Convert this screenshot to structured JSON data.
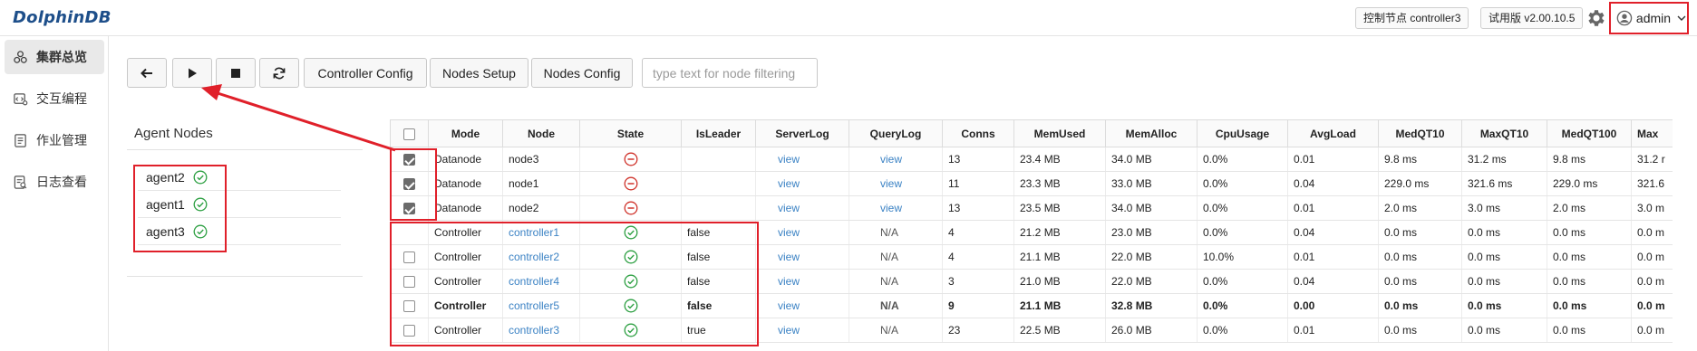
{
  "header": {
    "logo": "DolphinDB",
    "controller_badge": "控制节点 controller3",
    "version_badge": "试用版 v2.00.10.5",
    "username": "admin"
  },
  "sidebar": {
    "items": [
      {
        "label": "集群总览",
        "icon": "cluster-icon",
        "active": true
      },
      {
        "label": "交互编程",
        "icon": "code-icon",
        "active": false
      },
      {
        "label": "作业管理",
        "icon": "jobs-icon",
        "active": false
      },
      {
        "label": "日志查看",
        "icon": "log-icon",
        "active": false
      }
    ]
  },
  "toolbar": {
    "back_icon": "arrow-left-icon",
    "start_icon": "play-icon",
    "stop_icon": "stop-icon",
    "refresh_icon": "refresh-icon",
    "controller_config": "Controller Config",
    "nodes_setup": "Nodes Setup",
    "nodes_config": "Nodes Config",
    "filter_placeholder": "type text for node filtering"
  },
  "agent_panel": {
    "title": "Agent Nodes",
    "agents": [
      "agent2",
      "agent1",
      "agent3"
    ]
  },
  "colors": {
    "ok": "#2ea043",
    "stopped": "#d0342c",
    "link": "#3b82c4",
    "annotation": "#e0202a"
  },
  "table": {
    "headers": [
      "Mode",
      "Node",
      "State",
      "IsLeader",
      "ServerLog",
      "QueryLog",
      "Conns",
      "MemUsed",
      "MemAlloc",
      "CpuUsage",
      "AvgLoad",
      "MedQT10",
      "MaxQT10",
      "MedQT100",
      "Max"
    ],
    "rows": [
      {
        "checked": true,
        "checkbox": true,
        "mode": "Datanode",
        "node": "node3",
        "state": "stopped",
        "isLeader": "",
        "serverLog": "view",
        "queryLog": "view",
        "conns": "13",
        "memUsed": "23.4 MB",
        "memAlloc": "34.0 MB",
        "cpu": "0.0%",
        "avgLoad": "0.01",
        "medQT10": "9.8 ms",
        "maxQT10": "31.2 ms",
        "medQT100": "9.8 ms",
        "max": "31.2 r"
      },
      {
        "checked": true,
        "checkbox": true,
        "mode": "Datanode",
        "node": "node1",
        "state": "stopped",
        "isLeader": "",
        "serverLog": "view",
        "queryLog": "view",
        "conns": "11",
        "memUsed": "23.3 MB",
        "memAlloc": "33.0 MB",
        "cpu": "0.0%",
        "avgLoad": "0.04",
        "medQT10": "229.0 ms",
        "maxQT10": "321.6 ms",
        "medQT100": "229.0 ms",
        "max": "321.6"
      },
      {
        "checked": true,
        "checkbox": true,
        "mode": "Datanode",
        "node": "node2",
        "state": "stopped",
        "isLeader": "",
        "serverLog": "view",
        "queryLog": "view",
        "conns": "13",
        "memUsed": "23.5 MB",
        "memAlloc": "34.0 MB",
        "cpu": "0.0%",
        "avgLoad": "0.01",
        "medQT10": "2.0 ms",
        "maxQT10": "3.0 ms",
        "medQT100": "2.0 ms",
        "max": "3.0 m"
      },
      {
        "checked": false,
        "checkbox": false,
        "mode": "Controller",
        "node": "controller1",
        "state": "running",
        "isLeader": "false",
        "serverLog": "view",
        "queryLog": "N/A",
        "conns": "4",
        "memUsed": "21.2 MB",
        "memAlloc": "23.0 MB",
        "cpu": "0.0%",
        "avgLoad": "0.04",
        "medQT10": "0.0 ms",
        "maxQT10": "0.0 ms",
        "medQT100": "0.0 ms",
        "max": "0.0 m"
      },
      {
        "checked": false,
        "checkbox": true,
        "mode": "Controller",
        "node": "controller2",
        "state": "running",
        "isLeader": "false",
        "serverLog": "view",
        "queryLog": "N/A",
        "conns": "4",
        "memUsed": "21.1 MB",
        "memAlloc": "22.0 MB",
        "cpu": "10.0%",
        "avgLoad": "0.01",
        "medQT10": "0.0 ms",
        "maxQT10": "0.0 ms",
        "medQT100": "0.0 ms",
        "max": "0.0 m"
      },
      {
        "checked": false,
        "checkbox": true,
        "mode": "Controller",
        "node": "controller4",
        "state": "running",
        "isLeader": "false",
        "serverLog": "view",
        "queryLog": "N/A",
        "conns": "3",
        "memUsed": "21.0 MB",
        "memAlloc": "22.0 MB",
        "cpu": "0.0%",
        "avgLoad": "0.04",
        "medQT10": "0.0 ms",
        "maxQT10": "0.0 ms",
        "medQT100": "0.0 ms",
        "max": "0.0 m"
      },
      {
        "checked": false,
        "checkbox": true,
        "bold": true,
        "mode": "Controller",
        "node": "controller5",
        "state": "running",
        "isLeader": "false",
        "serverLog": "view",
        "queryLog": "N/A",
        "conns": "9",
        "memUsed": "21.1 MB",
        "memAlloc": "32.8 MB",
        "cpu": "0.0%",
        "avgLoad": "0.00",
        "medQT10": "0.0 ms",
        "maxQT10": "0.0 ms",
        "medQT100": "0.0 ms",
        "max": "0.0 m"
      },
      {
        "checked": false,
        "checkbox": true,
        "mode": "Controller",
        "node": "controller3",
        "state": "running",
        "isLeader": "true",
        "serverLog": "view",
        "queryLog": "N/A",
        "conns": "23",
        "memUsed": "22.5 MB",
        "memAlloc": "26.0 MB",
        "cpu": "0.0%",
        "avgLoad": "0.01",
        "medQT10": "0.0 ms",
        "maxQT10": "0.0 ms",
        "medQT100": "0.0 ms",
        "max": "0.0 m"
      }
    ]
  }
}
